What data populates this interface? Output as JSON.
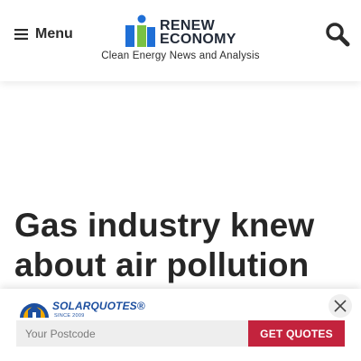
{
  "header": {
    "menu_label": "Menu",
    "logo_word_1": "RENEW",
    "logo_word_2": "ECONOMY",
    "tagline": "Clean Energy News and Analysis"
  },
  "article": {
    "headline": "Gas industry knew about air pollution"
  },
  "promo": {
    "brand": "SOLARQUOTES",
    "trademark": "®",
    "since": "SINCE 2009",
    "postcode_placeholder": "Your Postcode",
    "button_label": "GET QUOTES"
  },
  "colors": {
    "logo_blue": "#1f6fd6",
    "logo_green": "#7ac143",
    "headline_text": "#262626",
    "cta_red": "#c3233d",
    "promo_blue": "#1d4f9f"
  },
  "icons": [
    "hamburger-icon",
    "search-icon",
    "close-icon",
    "solarquotes-house-icon"
  ]
}
